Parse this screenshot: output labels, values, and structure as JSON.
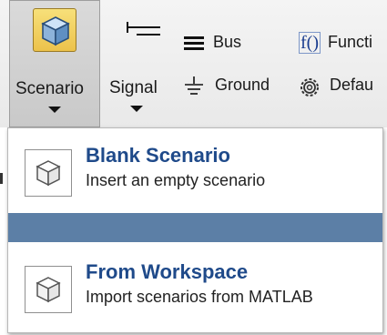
{
  "toolstrip": {
    "scenario": {
      "label": "Scenario",
      "icon": "cube-icon"
    },
    "signal": {
      "label": "Signal",
      "icon": "signal-line-icon"
    },
    "bus": {
      "label": "Bus",
      "icon": "bus-lines-icon"
    },
    "ground": {
      "label": "Ground",
      "icon": "ground-icon"
    },
    "function": {
      "label": "Functi",
      "glyph": "f()",
      "icon": "function-icon"
    },
    "default": {
      "label": "Defau",
      "icon": "gear-icon"
    }
  },
  "menu": {
    "items": [
      {
        "title": "Blank Scenario",
        "description": "Insert an empty scenario",
        "icon": "cube-icon"
      },
      {
        "title": "From Workspace",
        "description": "Import scenarios from MATLAB",
        "icon": "cube-icon"
      }
    ],
    "highlight_color": "#5c7fa6"
  },
  "colors": {
    "accent_title": "#1f4a8a",
    "scenario_icon": "#ecc24b"
  }
}
